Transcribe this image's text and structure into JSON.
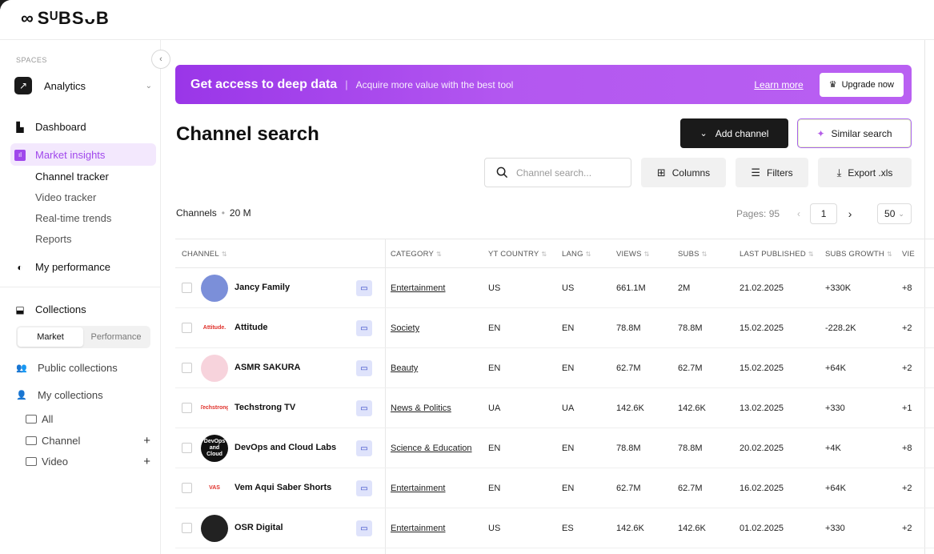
{
  "brand": {
    "logo_text": "SᵁBSᴗB"
  },
  "sidebar": {
    "spaces_label": "SPACES",
    "space_name": "Analytics",
    "nav": [
      {
        "label": "Dashboard"
      },
      {
        "label": "Market insights"
      },
      {
        "label": "My performance"
      },
      {
        "label": "Collections"
      }
    ],
    "market_sub": [
      "Channel tracker",
      "Video tracker",
      "Real-time trends",
      "Reports"
    ],
    "segment": [
      "Market",
      "Performance"
    ],
    "public_collections": "Public collections",
    "my_collections": "My collections",
    "folders": [
      "All",
      "Channel",
      "Video"
    ]
  },
  "banner": {
    "title": "Get access to deep data",
    "subtitle": "Acquire more value with the best tool",
    "link": "Learn more",
    "button": "Upgrade now"
  },
  "header": {
    "title": "Channel search",
    "add_channel": "Add channel",
    "similar_search": "Similar search",
    "search_placeholder": "Channel search...",
    "columns": "Columns",
    "filters": "Filters",
    "export": "Export .xls"
  },
  "summary": {
    "label": "Channels",
    "count": "20 M",
    "pages_label": "Pages: 95",
    "page": "1",
    "per_page": "50"
  },
  "table": {
    "headers": [
      "CHANNEL",
      "CATEGORY",
      "YT COUNTRY",
      "LANG",
      "VIEWS",
      "SUBS",
      "LAST PUBLISHED",
      "SUBS GROWTH",
      "VIE"
    ],
    "rows": [
      {
        "name": "Jancy Family",
        "avatar_text": "",
        "avatar_color": "#7b8fd9",
        "category": "Entertainment",
        "country": "US",
        "lang": "US",
        "views": "661.1M",
        "subs": "2M",
        "last": "21.02.2025",
        "growth": "+330K",
        "vie": "+8"
      },
      {
        "name": "Attitude",
        "avatar_text": "Attitude.",
        "avatar_color": "#ffffff",
        "category": "Society",
        "country": "EN",
        "lang": "EN",
        "views": "78.8M",
        "subs": "78.8M",
        "last": "15.02.2025",
        "growth": "-228.2K",
        "vie": "+2"
      },
      {
        "name": "ASMR SAKURA",
        "avatar_text": "",
        "avatar_color": "#f7d3dc",
        "category": "Beauty",
        "country": "EN",
        "lang": "EN",
        "views": "62.7M",
        "subs": "62.7M",
        "last": "15.02.2025",
        "growth": "+64K",
        "vie": "+2"
      },
      {
        "name": "Techstrong TV",
        "avatar_text": "Techstrong",
        "avatar_color": "#ffffff",
        "category": "News & Politics",
        "country": "UA",
        "lang": "UA",
        "views": "142.6K",
        "subs": "142.6K",
        "last": "13.02.2025",
        "growth": "+330",
        "vie": "+1"
      },
      {
        "name": "DevOps and Cloud Labs",
        "avatar_text": "DevOps and Cloud",
        "avatar_color": "#111111",
        "category": "Science & Education",
        "country": "EN",
        "lang": "EN",
        "views": "78.8M",
        "subs": "78.8M",
        "last": "20.02.2025",
        "growth": "+4K",
        "vie": "+8"
      },
      {
        "name": "Vem Aqui Saber Shorts",
        "avatar_text": "VAS",
        "avatar_color": "#ffffff",
        "category": "Entertainment",
        "country": "EN",
        "lang": "EN",
        "views": "62.7M",
        "subs": "62.7M",
        "last": "16.02.2025",
        "growth": "+64K",
        "vie": "+2"
      },
      {
        "name": "OSR Digital",
        "avatar_text": "",
        "avatar_color": "#222222",
        "category": "Entertainment",
        "country": "US",
        "lang": "ES",
        "views": "142.6K",
        "subs": "142.6K",
        "last": "01.02.2025",
        "growth": "+330",
        "vie": "+2"
      }
    ]
  },
  "colors": {
    "accent": "#a048ec",
    "active_bg": "#f3e8fd",
    "banner_start": "#9a36e8",
    "banner_end": "#b960f2"
  }
}
